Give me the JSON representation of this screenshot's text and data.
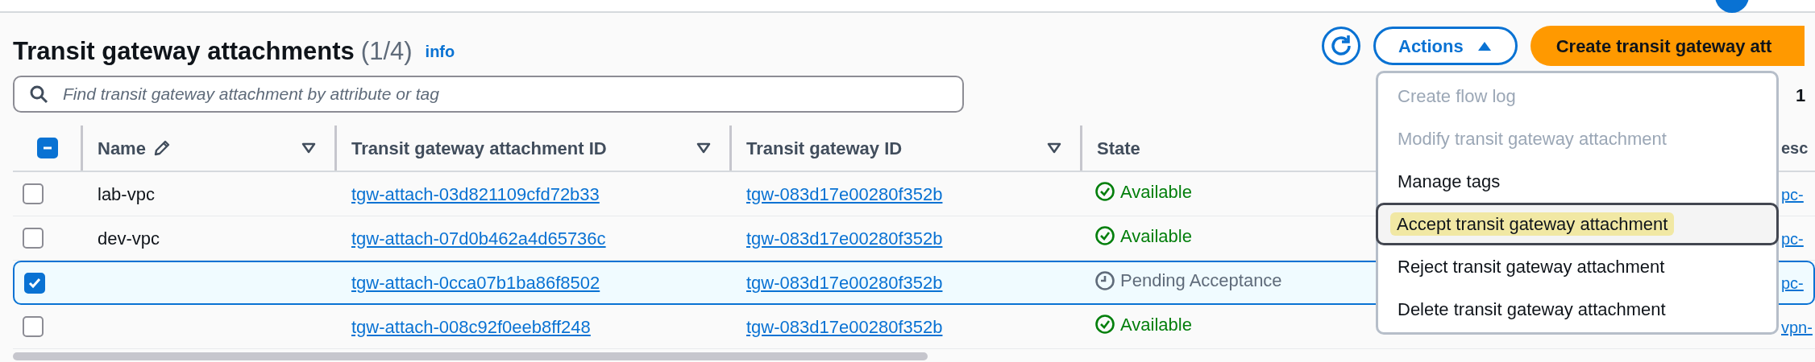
{
  "header": {
    "title": "Transit gateway attachments",
    "count": "(1/4)",
    "info": "info"
  },
  "toolbar": {
    "actions": {
      "label": "Actions",
      "expanded": true
    },
    "create_button": "Create transit gateway att"
  },
  "search": {
    "placeholder": "Find transit gateway attachment by attribute or tag"
  },
  "pagination": "1",
  "table": {
    "header_checkbox": {
      "indeterminate": true
    },
    "columns": [
      {
        "label": "Name",
        "editable": true,
        "sortable": true
      },
      {
        "label": "Transit gateway attachment ID",
        "editable": false,
        "sortable": true
      },
      {
        "label": "Transit gateway ID",
        "editable": false,
        "sortable": true
      },
      {
        "label": "State",
        "editable": false
      },
      {
        "label": "esc"
      }
    ],
    "rows": [
      {
        "selected": false,
        "name": "lab-vpc",
        "attachment_id": "tgw-attach-03d821109cfd72b33",
        "gateway_id": "tgw-083d17e00280f352b",
        "state": {
          "kind": "available",
          "text": "Available"
        },
        "column_5": "pc-"
      },
      {
        "selected": false,
        "name": "dev-vpc",
        "attachment_id": "tgw-attach-07d0b462a4d65736c",
        "gateway_id": "tgw-083d17e00280f352b",
        "state": {
          "kind": "available",
          "text": "Available"
        },
        "column_5": "pc-"
      },
      {
        "selected": true,
        "attachment_id": "tgw-attach-0cca07b1ba86f8502",
        "gateway_id": "tgw-083d17e00280f352b",
        "state": {
          "kind": "pending",
          "text": "Pending Acceptance"
        },
        "column_5": "pc-"
      },
      {
        "selected": false,
        "attachment_id": "tgw-attach-008c92f0eeb8ff248",
        "gateway_id": "tgw-083d17e00280f352b",
        "state": {
          "kind": "available",
          "text": "Available"
        },
        "column_5": "vpn-"
      }
    ]
  },
  "menu": {
    "items": [
      {
        "label": "Create flow log",
        "disabled": true,
        "focused": false
      },
      {
        "label": "Modify transit gateway attachment",
        "disabled": true,
        "focused": false
      },
      {
        "label": "Manage tags",
        "disabled": false,
        "focused": false
      },
      {
        "label": "Accept transit gateway attachment",
        "disabled": false,
        "focused": true
      },
      {
        "label": "Reject transit gateway attachment",
        "disabled": false,
        "focused": false
      },
      {
        "label": "Delete transit gateway attachment",
        "disabled": false,
        "focused": false
      }
    ]
  }
}
